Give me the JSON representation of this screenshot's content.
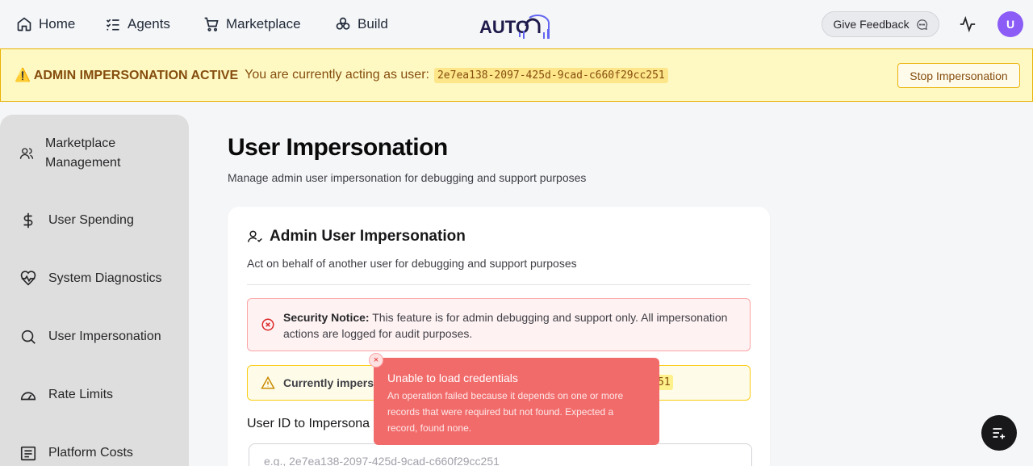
{
  "nav": {
    "home": "Home",
    "agents": "Agents",
    "marketplace": "Marketplace",
    "build": "Build",
    "feedback": "Give Feedback",
    "avatar_initial": "U"
  },
  "banner": {
    "title": "⚠️ ADMIN IMPERSONATION ACTIVE",
    "text": "You are currently acting as user:",
    "user_id": "2e7ea138-2097-425d-9cad-c660f29cc251",
    "stop_label": "Stop Impersonation"
  },
  "sidebar": {
    "items": [
      {
        "label": "Marketplace Management",
        "icon": "users-icon"
      },
      {
        "label": "User Spending",
        "icon": "dollar-icon"
      },
      {
        "label": "System Diagnostics",
        "icon": "heart-pulse-icon"
      },
      {
        "label": "User Impersonation",
        "icon": "search-icon"
      },
      {
        "label": "Rate Limits",
        "icon": "gauge-icon"
      },
      {
        "label": "Platform Costs",
        "icon": "receipt-icon"
      }
    ]
  },
  "main": {
    "title": "User Impersonation",
    "subtitle": "Manage admin user impersonation for debugging and support purposes"
  },
  "card": {
    "title": "Admin User Impersonation",
    "description": "Act on behalf of another user for debugging and support purposes",
    "notice_bold": "Security Notice:",
    "notice_text": " This feature is for admin debugging and support only. All impersonation actions are logged for audit purposes.",
    "current_label": "Currently impers",
    "current_code": "51",
    "field_label": "User ID to Impersona",
    "field_placeholder": "e.g., 2e7ea138-2097-425d-9cad-c660f29cc251"
  },
  "toast": {
    "title": "Unable to load credentials",
    "body": "An operation failed because it depends on one or more records that were required but not found. Expected a record, found none.",
    "close": "×"
  },
  "colors": {
    "banner_bg": "#fef9c3",
    "banner_border": "#eab308",
    "toast_bg": "#f26b6b",
    "avatar": "#8b5cf6"
  }
}
